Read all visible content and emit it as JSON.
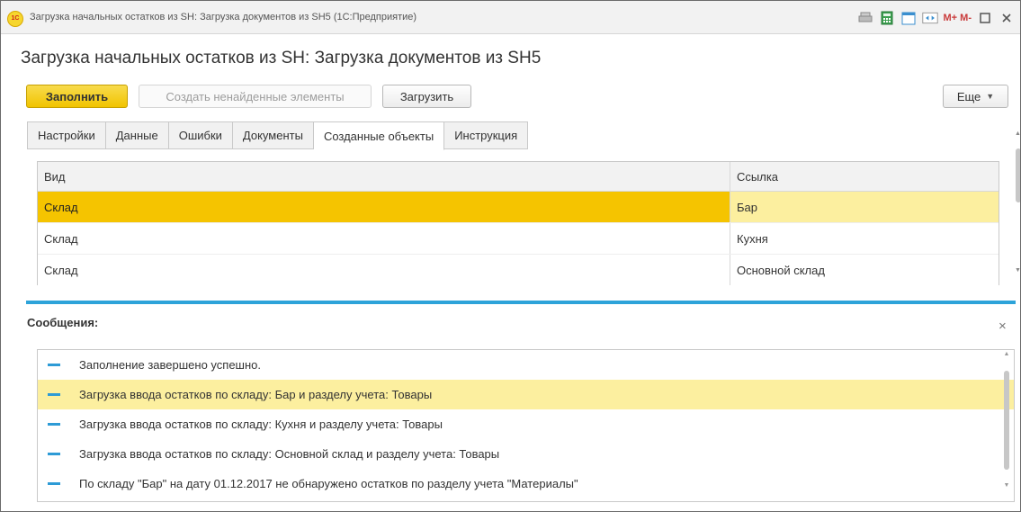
{
  "window": {
    "title": "Загрузка начальных остатков из SH: Загрузка документов из SH5  (1С:Предприятие)",
    "logo_text": "1С",
    "memory_buttons": "M+ M-"
  },
  "form": {
    "title": "Загрузка начальных остатков из SH: Загрузка документов из SH5"
  },
  "toolbar": {
    "fill_label": "Заполнить",
    "create_missing_label": "Создать ненайденные элементы",
    "load_label": "Загрузить",
    "more_label": "Еще"
  },
  "tabs": [
    {
      "label": "Настройки",
      "active": false
    },
    {
      "label": "Данные",
      "active": false
    },
    {
      "label": "Ошибки",
      "active": false
    },
    {
      "label": "Документы",
      "active": false
    },
    {
      "label": "Созданные объекты",
      "active": true
    },
    {
      "label": "Инструкция",
      "active": false
    }
  ],
  "table": {
    "columns": [
      "Вид",
      "Ссылка"
    ],
    "rows": [
      {
        "vid": "Склад",
        "ref": "Бар",
        "selected": true
      },
      {
        "vid": "Склад",
        "ref": "Кухня",
        "selected": false
      },
      {
        "vid": "Склад",
        "ref": "Основной склад",
        "selected": false
      }
    ]
  },
  "messages": {
    "title": "Сообщения:",
    "close_glyph": "×",
    "items": [
      {
        "text": "Заполнение завершено успешно.",
        "selected": false
      },
      {
        "text": "Загрузка ввода остатков по складу: Бар и разделу учета: Товары",
        "selected": true
      },
      {
        "text": "Загрузка ввода остатков по складу: Кухня и разделу учета: Товары",
        "selected": false
      },
      {
        "text": "Загрузка ввода остатков по складу: Основной склад и разделу учета: Товары",
        "selected": false
      },
      {
        "text": "По складу \"Бар\" на дату 01.12.2017 не обнаружено остатков по разделу учета \"Материалы\"",
        "selected": false
      }
    ]
  },
  "colors": {
    "accent": "#f1c400",
    "selection": "#fcef9f",
    "splitter": "#2da3d9"
  }
}
